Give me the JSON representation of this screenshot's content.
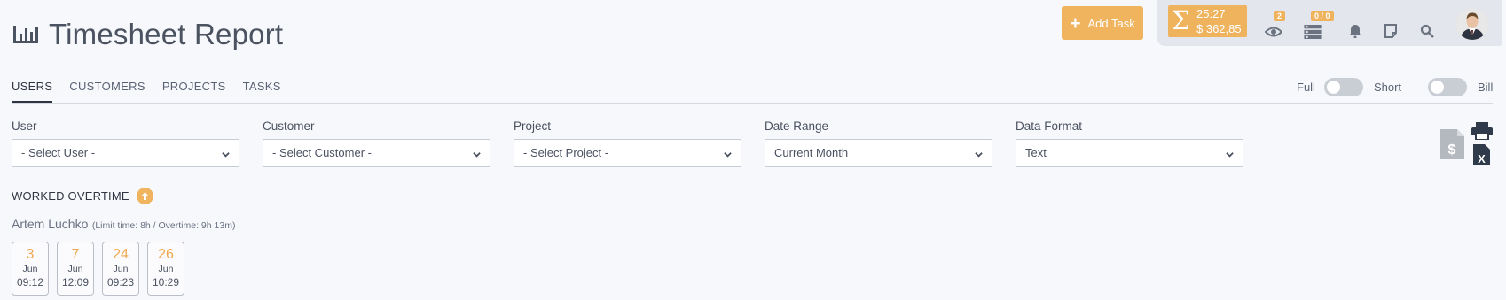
{
  "header": {
    "title": "Timesheet Report",
    "add_task_label": "Add Task"
  },
  "topbar": {
    "timer_time": "25:27",
    "timer_amount": "$ 362,85",
    "watch_badge": "2",
    "tasks_badge": "0 / 0"
  },
  "tabs": [
    "USERS",
    "CUSTOMERS",
    "PROJECTS",
    "TASKS"
  ],
  "toggles": {
    "full_label": "Full",
    "short_label": "Short",
    "bill_label": "Bill"
  },
  "filters": {
    "user": {
      "label": "User",
      "value": "- Select User -"
    },
    "customer": {
      "label": "Customer",
      "value": "- Select Customer -"
    },
    "project": {
      "label": "Project",
      "value": "- Select Project -"
    },
    "date_range": {
      "label": "Date Range",
      "value": "Current Month"
    },
    "data_format": {
      "label": "Data Format",
      "value": "Text"
    }
  },
  "overtime": {
    "heading": "WORKED OVERTIME",
    "user_name": "Artem Luchko",
    "limit_note": "(Limit time: 8h / Overtime: 9h 13m)",
    "days": [
      {
        "day": "3",
        "month": "Jun",
        "time": "09:12"
      },
      {
        "day": "7",
        "month": "Jun",
        "time": "12:09"
      },
      {
        "day": "24",
        "month": "Jun",
        "time": "09:23"
      },
      {
        "day": "26",
        "month": "Jun",
        "time": "10:29"
      }
    ]
  },
  "colors": {
    "accent": "#efb35e",
    "text": "#4a5160",
    "topbar": "#e3e6ec"
  }
}
